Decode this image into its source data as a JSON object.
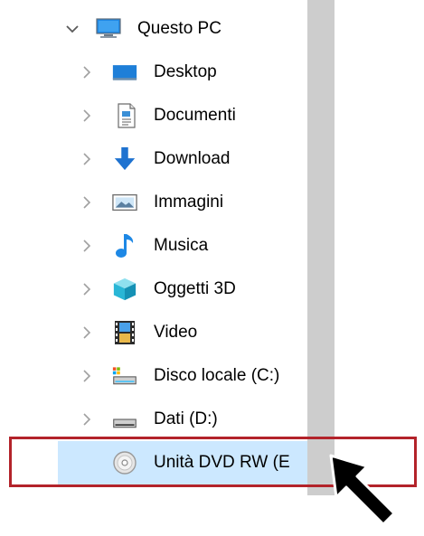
{
  "tree": {
    "root": {
      "label": "Questo PC",
      "icon": "computer-icon",
      "expanded": true
    },
    "children": [
      {
        "label": "Desktop",
        "icon": "desktop-folder-icon"
      },
      {
        "label": "Documenti",
        "icon": "documents-folder-icon"
      },
      {
        "label": "Download",
        "icon": "download-arrow-icon"
      },
      {
        "label": "Immagini",
        "icon": "pictures-folder-icon"
      },
      {
        "label": "Musica",
        "icon": "music-note-icon"
      },
      {
        "label": "Oggetti 3D",
        "icon": "3d-objects-icon"
      },
      {
        "label": "Video",
        "icon": "video-film-icon"
      },
      {
        "label": "Disco locale (C:)",
        "icon": "system-drive-icon"
      },
      {
        "label": "Dati (D:)",
        "icon": "hard-drive-icon"
      },
      {
        "label": "Unità DVD RW (E",
        "icon": "dvd-disc-icon",
        "selected": true
      }
    ]
  },
  "colors": {
    "selection": "#cce8ff",
    "highlight_border": "#b3232a",
    "scrollbar": "#cdcdcd",
    "chevron": "#808080"
  }
}
